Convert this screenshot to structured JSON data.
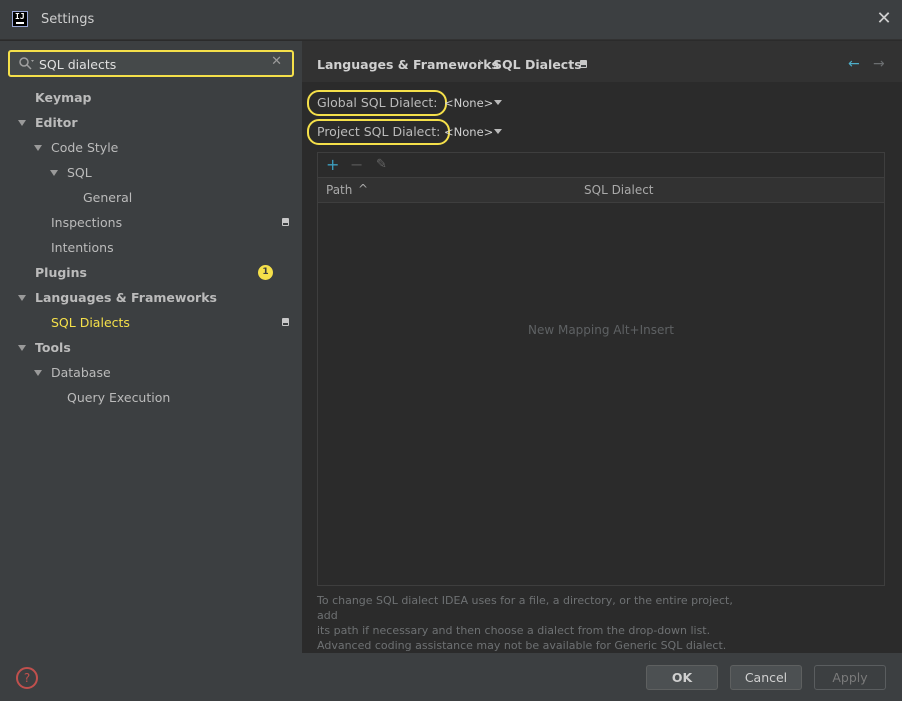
{
  "window": {
    "title": "Settings",
    "logo_text": "IJ",
    "close_glyph": "✕"
  },
  "search": {
    "value": "SQL dialects",
    "placeholder": "",
    "clear_glyph": "✕"
  },
  "tree": {
    "keymap": "Keymap",
    "editor": "Editor",
    "code_style": "Code Style",
    "sql": "SQL",
    "general": "General",
    "inspections": "Inspections",
    "intentions": "Intentions",
    "plugins": "Plugins",
    "plugins_badge": "1",
    "languages_frameworks": "Languages & Frameworks",
    "sql_dialects": "SQL Dialects",
    "tools": "Tools",
    "database": "Database",
    "query_execution": "Query Execution"
  },
  "breadcrumb": {
    "parent": "Languages & Frameworks",
    "separator": "›",
    "current": "SQL Dialects",
    "back_glyph": "←",
    "forward_glyph": "→"
  },
  "form": {
    "global_label": "Global SQL Dialect:",
    "global_value": "<None>",
    "project_label": "Project SQL Dialect:",
    "project_value": "<None>"
  },
  "table": {
    "add_glyph": "+",
    "remove_glyph": "−",
    "edit_glyph": "✎",
    "columns": [
      "Path",
      "SQL Dialect"
    ],
    "sort_glyph": "^",
    "empty_text": "New Mapping Alt+Insert"
  },
  "help_text": [
    "To change SQL dialect IDEA uses for a file, a directory, or the entire project, add",
    "its path if necessary and then choose a dialect from the drop-down list.",
    "Advanced coding assistance may not be available for Generic SQL dialect."
  ],
  "footer": {
    "help_glyph": "?",
    "ok_label": "OK",
    "cancel_label": "Cancel",
    "apply_label": "Apply"
  },
  "colors": {
    "accent_yellow": "#f5e04a",
    "nav_back": "#4eaec9",
    "add_green": "#3c9dbe"
  },
  "icons": [
    "search-icon",
    "close-icon",
    "document-icon",
    "arrow-left-icon",
    "arrow-right-icon",
    "add-icon",
    "remove-icon",
    "edit-icon",
    "help-icon"
  ]
}
